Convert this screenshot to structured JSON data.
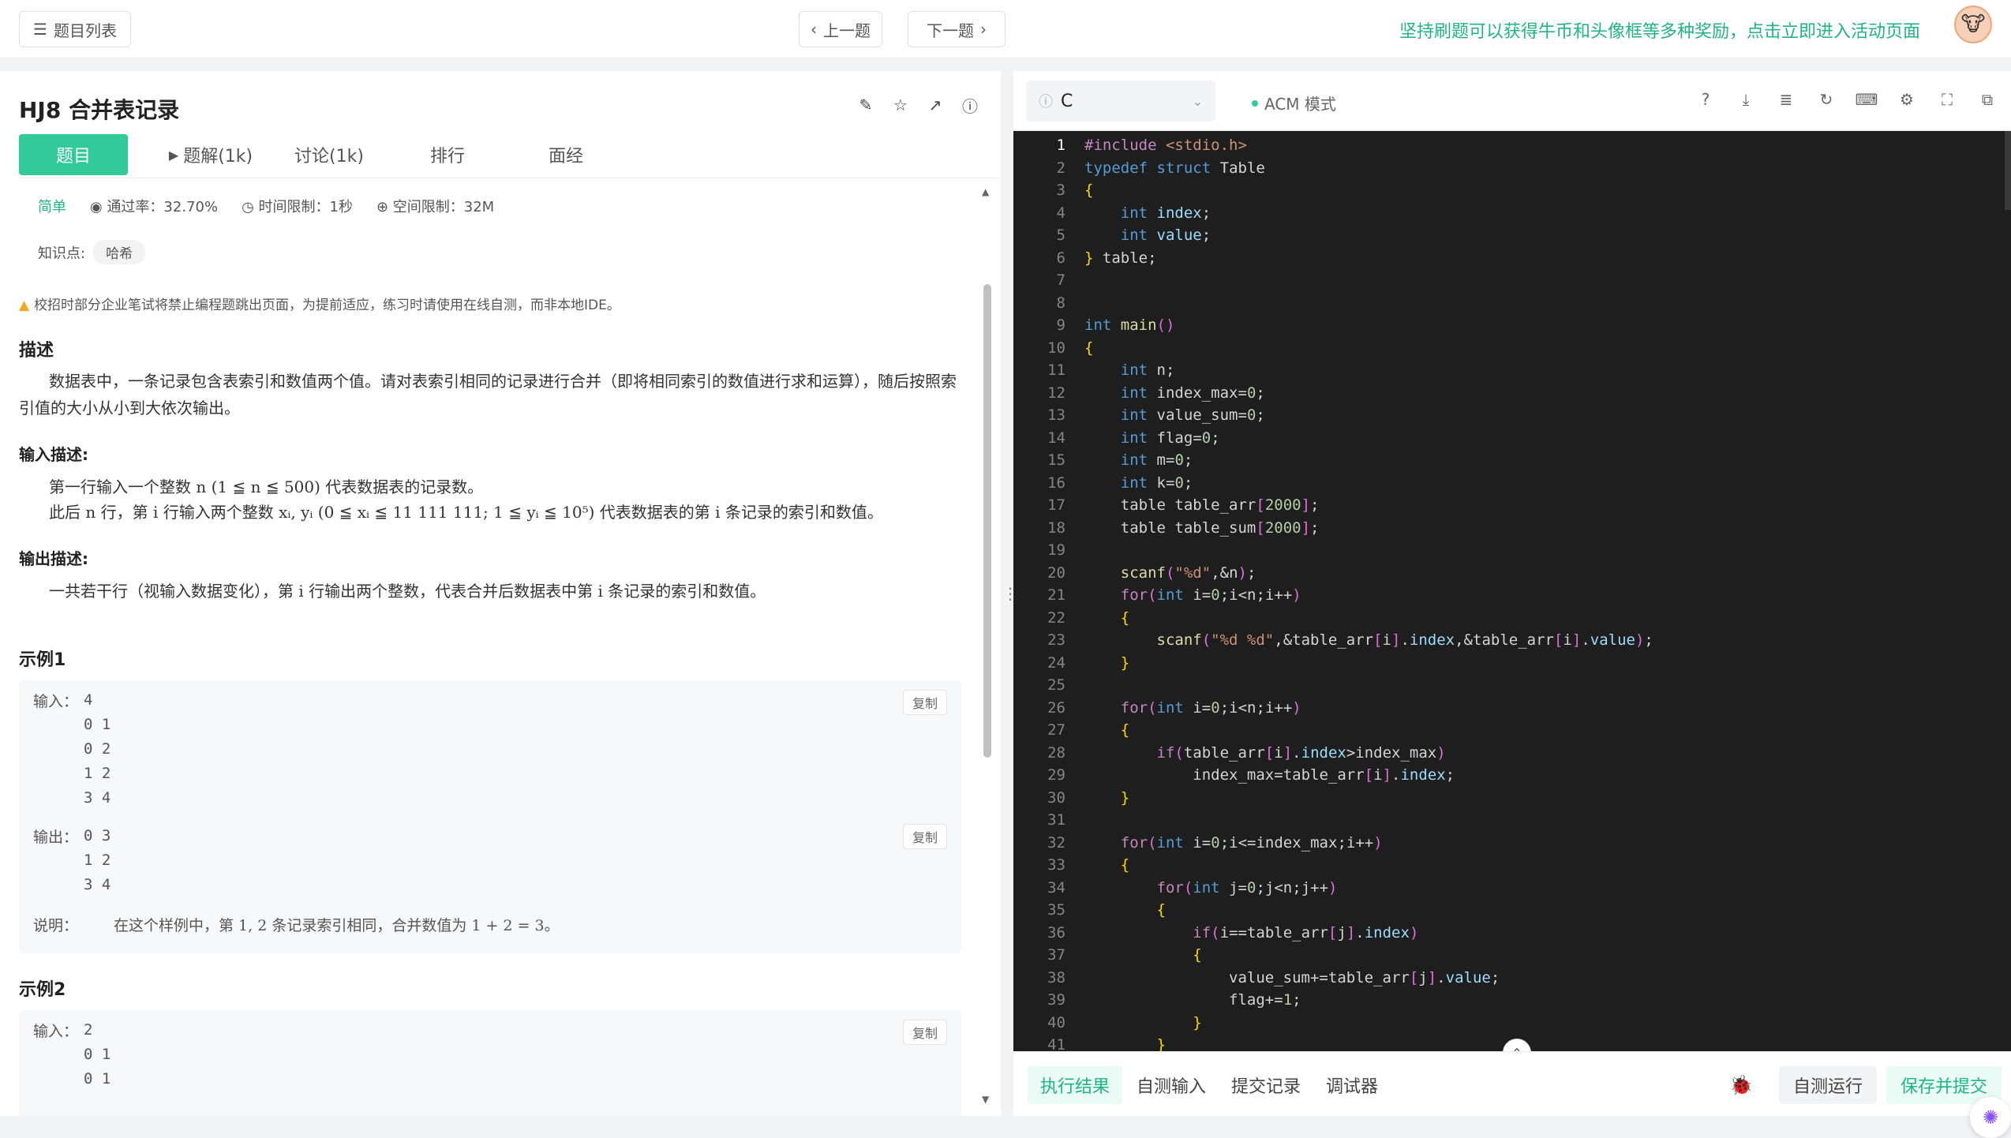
{
  "topbar": {
    "problem_list": "题目列表",
    "prev": "上一题",
    "next": "下一题",
    "promo": "坚持刷题可以获得牛币和头像框等多种奖励，点击立即进入活动页面"
  },
  "problem": {
    "title": "HJ8  合并表记录",
    "tabs": [
      {
        "label": "题目"
      },
      {
        "label": "题解(1k)"
      },
      {
        "label": "讨论(1k)"
      },
      {
        "label": "排行"
      },
      {
        "label": "面经"
      }
    ],
    "difficulty": "简单",
    "pass_rate": "通过率：32.70%",
    "time_limit": "时间限制：1秒",
    "space_limit": "空间限制：32M",
    "knowledge_label": "知识点:",
    "knowledge_tag": "哈希",
    "warning": "校招时部分企业笔试将禁止编程题跳出页面，为提前适应，练习时请使用在线自测，而非本地IDE。",
    "desc_title": "描述",
    "desc_text": "数据表中，一条记录包含表索引和数值两个值。请对表索引相同的记录进行合并（即将相同索引的数值进行求和运算），随后按照索引值的大小从小到大依次输出。",
    "input_title": "输入描述:",
    "input_line1": "第一行输入一个整数 n (1 ≦ n ≦ 500) 代表数据表的记录数。",
    "input_line2": "此后 n 行，第 i 行输入两个整数 xᵢ, yᵢ (0 ≦ xᵢ ≦ 11 111 111; 1 ≦ yᵢ ≦ 10⁵) 代表数据表的第 i 条记录的索引和数值。",
    "output_title": "输出描述:",
    "output_text": "一共若干行（视输入数据变化），第 i 行输出两个整数，代表合并后数据表中第 i 条记录的索引和数值。",
    "example1_title": "示例1",
    "example2_title": "示例2",
    "input_label": "输入：",
    "output_label": "输出：",
    "explain_label": "说明：",
    "copy": "复制",
    "ex1_input": [
      "4",
      "0 1",
      "0 2",
      "1 2",
      "3 4"
    ],
    "ex1_output": [
      "0 3",
      "1 2",
      "3 4"
    ],
    "ex1_explain": "在这个样例中，第  1, 2  条记录索引相同，合并数值为  1 + 2 = 3。",
    "ex2_input": [
      "2",
      "0 1",
      "0 1"
    ]
  },
  "editor": {
    "language": "C",
    "mode": "ACM 模式",
    "tabs": [
      {
        "label": "执行结果"
      },
      {
        "label": "自测输入"
      },
      {
        "label": "提交记录"
      },
      {
        "label": "调试器"
      }
    ],
    "run": "自测运行",
    "submit": "保存并提交"
  },
  "code_lines": [
    "#include <stdio.h>",
    "typedef struct Table",
    "{",
    "    int index;",
    "    int value;",
    "} table;",
    "",
    "",
    "int main()",
    "{",
    "    int n;",
    "    int index_max=0;",
    "    int value_sum=0;",
    "    int flag=0;",
    "    int m=0;",
    "    int k=0;",
    "    table table_arr[2000];",
    "    table table_sum[2000];",
    "",
    "    scanf(\"%d\",&n);",
    "    for(int i=0;i<n;i++)",
    "    {",
    "        scanf(\"%d %d\",&table_arr[i].index,&table_arr[i].value);",
    "    }",
    "",
    "    for(int i=0;i<n;i++)",
    "    {",
    "        if(table_arr[i].index>index_max)",
    "            index_max=table_arr[i].index;",
    "    }",
    "",
    "    for(int i=0;i<=index_max;i++)",
    "    {",
    "        for(int j=0;j<n;j++)",
    "        {",
    "            if(i==table_arr[j].index)",
    "            {",
    "                value_sum+=table_arr[j].value;",
    "                flag+=1;",
    "            }",
    "        }"
  ]
}
